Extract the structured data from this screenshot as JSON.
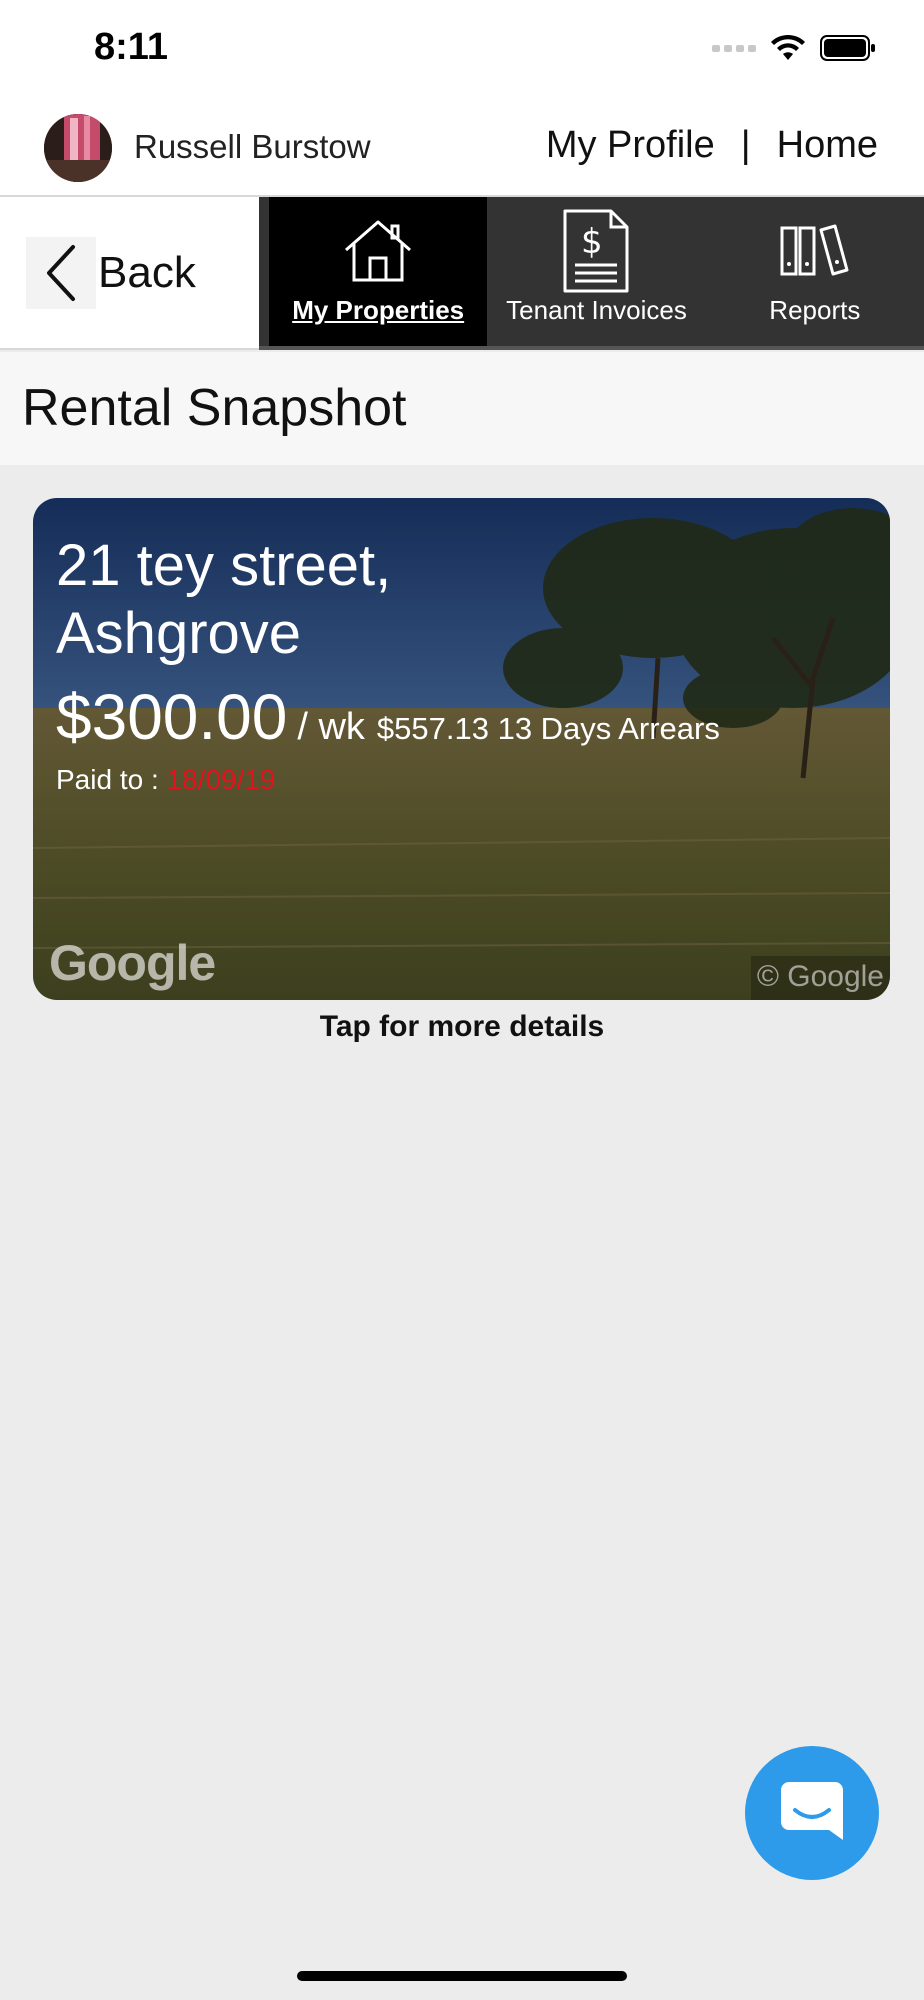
{
  "status_bar": {
    "time": "8:11",
    "icons": [
      "signal-icon",
      "wifi-icon",
      "battery-icon"
    ]
  },
  "header": {
    "user_name": "Russell Burstow",
    "links": {
      "profile": "My Profile",
      "separator": "|",
      "home": "Home"
    }
  },
  "nav": {
    "back_label": "Back",
    "tabs": [
      {
        "label": "My Properties",
        "icon": "house-icon",
        "active": true
      },
      {
        "label": "Tenant Invoices",
        "icon": "invoice-icon",
        "active": false
      },
      {
        "label": "Reports",
        "icon": "books-icon",
        "active": false
      }
    ]
  },
  "page": {
    "title": "Rental Snapshot"
  },
  "property": {
    "address": "21 tey street, Ashgrove",
    "rent": "$300.00",
    "rent_unit": "/ wk",
    "arrears": "$557.13 13 Days Arrears",
    "paid_to_label": "Paid to :",
    "paid_to_date": "18/09/19",
    "map_logo": "Google",
    "map_copyright": "© Google"
  },
  "tap_hint": "Tap for more details",
  "colors": {
    "accent_blue": "#2d9bea",
    "alert_red": "#e5121d",
    "tab_bar": "#333333",
    "tab_active": "#000000"
  }
}
